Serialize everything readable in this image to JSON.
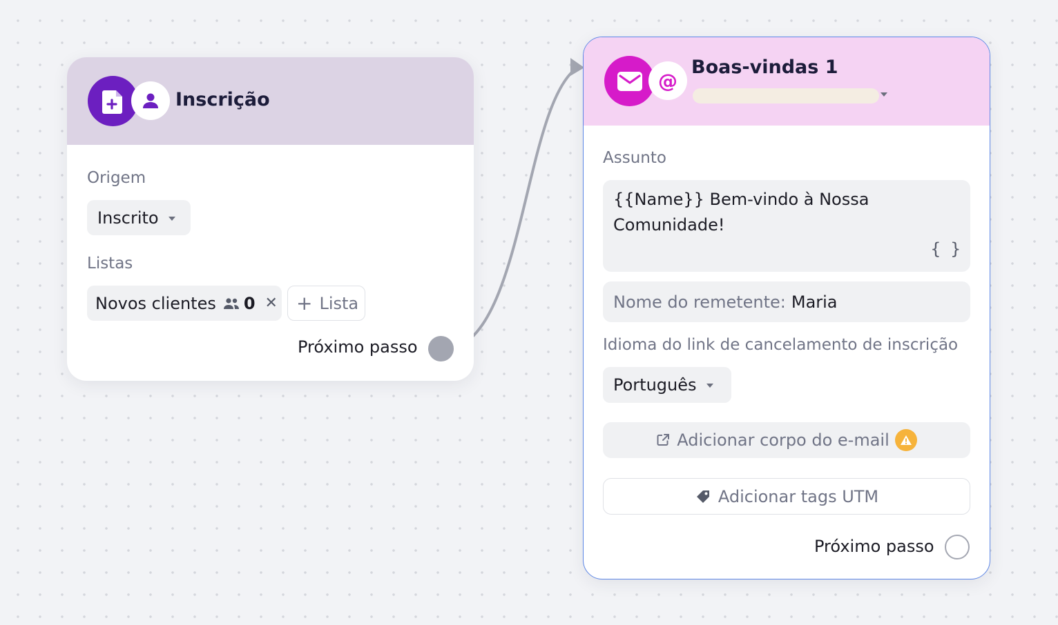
{
  "node_inscricao": {
    "title": "Inscrição",
    "main_icon": "form-add-icon",
    "sub_icon": "person-icon",
    "origem_label": "Origem",
    "origem_value": "Inscrito",
    "listas_label": "Listas",
    "list_chip": {
      "name": "Novos clientes",
      "icon": "people-icon",
      "count": "0",
      "remove_icon": "close-icon"
    },
    "add_list_label": "Lista",
    "next_step_label": "Próximo passo"
  },
  "node_email": {
    "title": "Boas-vindas 1",
    "main_icon": "envelope-icon",
    "sub_icon": "at-sign-icon",
    "assunto_label": "Assunto",
    "subject_text": "{{Name}} Bem-vindo à Nossa Comunidade!",
    "variables_icon": "{ }",
    "sender_prefix": "Nome do remetente:",
    "sender_value": "Maria",
    "unsubscribe_lang_label": "Idioma do link de cancelamento de inscrição",
    "unsubscribe_lang_value": "Português",
    "add_body_label": "Adicionar corpo do e-mail",
    "add_body_icon": "external-edit-icon",
    "warning_icon": "warning-icon",
    "add_utm_label": "Adicionar tags UTM",
    "utm_icon": "tag-icon",
    "next_step_label": "Próximo passo"
  },
  "colors": {
    "node1_header": "#dcd3e4",
    "node1_icon": "#6c1fc0",
    "node2_header": "#f5d3f3",
    "node2_icon": "#d61bc9",
    "selected_border": "#5c86e6",
    "warning": "#f6b33b",
    "connector": "#a3a6b1"
  }
}
